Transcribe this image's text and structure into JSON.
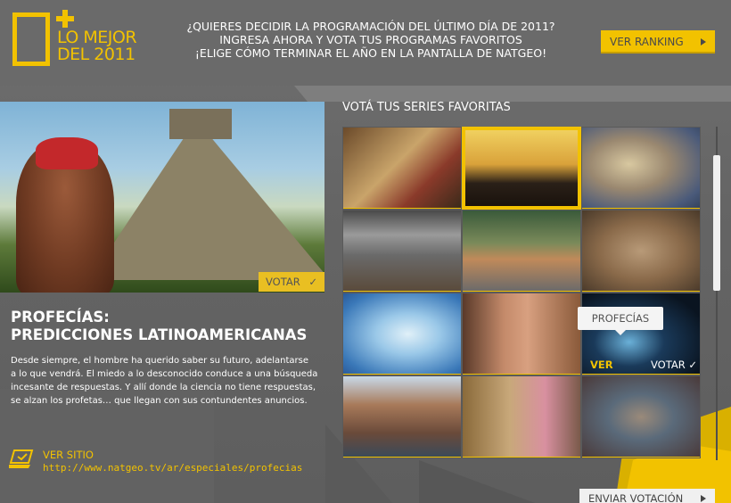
{
  "logo": {
    "line1": "LO MEJOR",
    "line2": "DEL 2011"
  },
  "header": {
    "promo_line1": "¿QUIERES DECIDIR LA PROGRAMACIÓN DEL ÚLTIMO DÍA DE 2011?",
    "promo_line2": "INGRESA AHORA Y VOTA TUS PROGRAMAS FAVORITOS",
    "promo_line3": "¡ELIGE CÓMO TERMINAR EL AÑO EN LA PANTALLA DE NATGEO!",
    "ranking_label": "VER RANKING"
  },
  "feature": {
    "votar_label": "VOTAR",
    "votar_check": "✓",
    "title_line1": "PROFECÍAS:",
    "title_line2": "PREDICCIONES LATINOAMERICANAS",
    "desc_lines": [
      "Desde siempre, el hombre ha querido saber su futuro, adelantarse",
      "a lo que vendrá. El miedo a lo desconocido conduce a una búsqueda",
      "incesante de respuestas. Y allí donde la ciencia no tiene respuestas,",
      "se alzan los profetas… que llegan con sus contundentes anuncios."
    ],
    "site_label": "VER SITIO",
    "site_url": "http://www.natgeo.tv/ar/especiales/profecias"
  },
  "grid": {
    "title": "VOTÁ TUS SERIES FAVORITAS",
    "tiles": [
      {
        "name": "altar"
      },
      {
        "name": "silhouette-handcuffs"
      },
      {
        "name": "loris"
      },
      {
        "name": "car-crash"
      },
      {
        "name": "catfish"
      },
      {
        "name": "creature"
      },
      {
        "name": "brain-glass"
      },
      {
        "name": "torso"
      },
      {
        "name": "profecias-space"
      },
      {
        "name": "cowboys"
      },
      {
        "name": "market-women"
      },
      {
        "name": "hoarders"
      }
    ],
    "selected_index": 1,
    "active_tile_index": 8,
    "tooltip": "PROFECÍAS",
    "ver_label": "VER",
    "votar_label": "VOTAR ✓"
  },
  "footer": {
    "enviar_label": "ENVIAR VOTACIÓN"
  },
  "colors": {
    "accent": "#f2c200",
    "background": "#6b6b6b"
  }
}
